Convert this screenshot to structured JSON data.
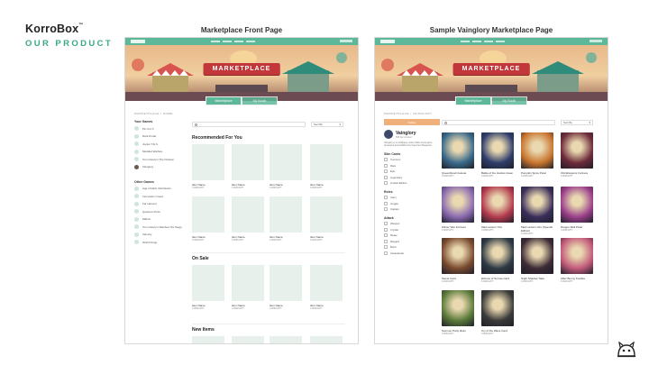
{
  "brand": {
    "name": "KorroBox",
    "tm": "™",
    "subtitle": "OUR PRODUCT"
  },
  "titles": {
    "left": "Marketplace Front Page",
    "right": "Sample Vainglory Marketplace Page"
  },
  "hero": {
    "banner": "MARKETPLACE"
  },
  "tabs": {
    "marketplace": "Marketplace",
    "mybooth": "My Booth"
  },
  "left": {
    "crumb": "MARKETPLACE / HOME",
    "your_games_title": "Your Games",
    "your_games": [
      "Pin Cut X",
      "Dark Portal",
      "Jupiter T.E.S",
      "Modded Warfare",
      "Tom Clancy's The Division",
      "Vainglory"
    ],
    "other_games_title": "Other Games",
    "other_games": [
      "Age of Dark: Retribution",
      "Innovation Creed",
      "Far Harvest",
      "Quantum Prize",
      "Mabos",
      "Tom Clancy's Rainbow Six Siege",
      "Velocity",
      "World Kings"
    ],
    "sort": "Sort By",
    "recommended_title": "Recommended For You",
    "onsale_title": "On Sale",
    "newitems_title": "New Items",
    "item_name": "Item Name",
    "item_price": "0.0000 ETH"
  },
  "right": {
    "crumb": "MARKETPLACE / VAINGLORY",
    "follow": "Follow",
    "game_name": "Vainglory",
    "game_meta": "500 items listed",
    "game_desc": "Vainglory is a multiplayer online battle arena game developed and published by Super Evil Megacorp.",
    "skin_title": "Skin Cards",
    "skins": [
      "Common",
      "Rare",
      "Epic",
      "Legendary",
      "Limited Edition"
    ],
    "role_title": "Roles",
    "roles": [
      "Carry",
      "Jungler",
      "Captain"
    ],
    "attack_title": "Attack",
    "attacks": [
      "Weapon",
      "Crystal",
      "Melee",
      "Ranged",
      "Burst",
      "Assassinate"
    ],
    "sort": "Sort By",
    "cards": [
      {
        "name": "Queenblood Celeste",
        "price": "0.0000 ETH"
      },
      {
        "name": "Battle of the Hordes Gwen",
        "price": "0.0000 ETH"
      },
      {
        "name": "Pumpkin Spice Petal",
        "price": "0.0000 ETH"
      },
      {
        "name": "Old-Weapons Fortress",
        "price": "0.0000 ETH"
      },
      {
        "name": "Winter War Fortress",
        "price": "0.0000 ETH"
      },
      {
        "name": "Mad Lantern Ozo",
        "price": "0.0000 ETH"
      },
      {
        "name": "Mad Lantern Ozo (Special Edition)",
        "price": "0.0000 ETH"
      },
      {
        "name": "Dragon Mail Petal",
        "price": "0.0000 ETH"
      },
      {
        "name": "Sweet Card",
        "price": "0.0000 ETH"
      },
      {
        "name": "Echoes of Sorrow Card",
        "price": "0.0000 ETH"
      },
      {
        "name": "Night Shadow Taka",
        "price": "0.0000 ETH"
      },
      {
        "name": "Killer Bunny Koshka",
        "price": "0.0000 ETH"
      },
      {
        "name": "Summer Party Reim",
        "price": "0.0000 ETH"
      },
      {
        "name": "Cry of the Wave Card",
        "price": "0.0000 ETH"
      }
    ],
    "card_colors": [
      "#3b6a8a",
      "#2f3e6a",
      "#c9762f",
      "#6d2b3a",
      "#8a6ab0",
      "#b33a4d",
      "#3a2e5a",
      "#9a3f8a",
      "#7a4a2e",
      "#2e3a44",
      "#3c2a35",
      "#c25a7a",
      "#5a7a3a",
      "#3a3a3a"
    ]
  }
}
